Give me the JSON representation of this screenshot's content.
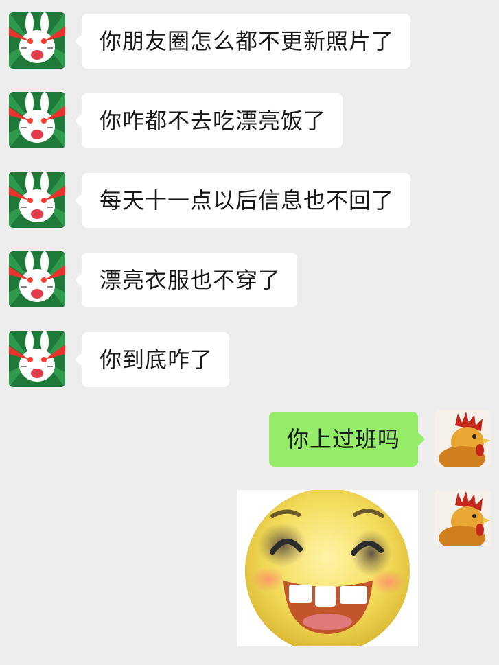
{
  "chat": {
    "incoming_sender": "rabbit-laser-eyes-avatar",
    "outgoing_sender": "rooster-avatar",
    "colors": {
      "background": "#ededed",
      "incoming_bubble": "#ffffff",
      "outgoing_bubble": "#95ec69",
      "text": "#191919"
    },
    "messages": [
      {
        "direction": "incoming",
        "text": "你朋友圈怎么都不更新照片了"
      },
      {
        "direction": "incoming",
        "text": "你咋都不去吃漂亮饭了"
      },
      {
        "direction": "incoming",
        "text": "每天十一点以后信息也不回了"
      },
      {
        "direction": "incoming",
        "text": "漂亮衣服也不穿了"
      },
      {
        "direction": "incoming",
        "text": "你到底咋了"
      },
      {
        "direction": "outgoing",
        "text": "你上过班吗"
      },
      {
        "direction": "outgoing",
        "type": "sticker",
        "sticker": "bruised-smiling-emoji-sticker"
      }
    ]
  }
}
